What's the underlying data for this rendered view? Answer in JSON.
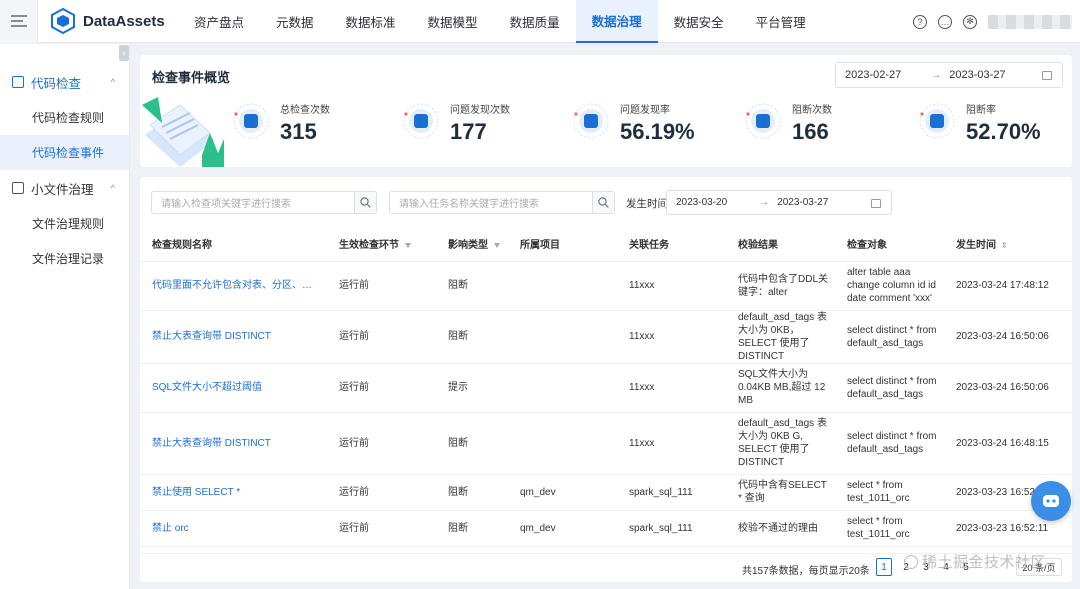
{
  "brand": {
    "name": "DataAssets"
  },
  "nav": [
    "资产盘点",
    "元数据",
    "数据标准",
    "数据模型",
    "数据质量",
    "数据治理",
    "数据安全",
    "平台管理"
  ],
  "nav_active_index": 5,
  "top_icons": [
    "help-icon",
    "message-icon",
    "settings-icon"
  ],
  "sidebar": {
    "groups": [
      {
        "label": "代码检查",
        "active": true,
        "items": [
          "代码检查规则",
          "代码检查事件"
        ]
      },
      {
        "label": "小文件治理",
        "active": false,
        "items": [
          "文件治理规则",
          "文件治理记录"
        ]
      }
    ],
    "active_item": "代码检查事件"
  },
  "overview": {
    "title": "检查事件概览",
    "range_start": "2023-02-27",
    "range_end": "2023-03-27",
    "stats": [
      {
        "label": "总检查次数",
        "value": "315"
      },
      {
        "label": "问题发现次数",
        "value": "177"
      },
      {
        "label": "问题发现率",
        "value": "56.19%"
      },
      {
        "label": "阻断次数",
        "value": "166"
      },
      {
        "label": "阻断率",
        "value": "52.70%"
      }
    ]
  },
  "filters": {
    "search1_placeholder": "请输入检查项关键字进行搜索",
    "search2_placeholder": "请输入任务名称关键字进行搜索",
    "date_label": "发生时间",
    "date_start": "2023-03-20",
    "date_end": "2023-03-27"
  },
  "table": {
    "columns": [
      "检查规则名称",
      "生效检查环节",
      "影响类型",
      "所属项目",
      "关联任务",
      "校验结果",
      "检查对象",
      "发生时间"
    ],
    "rows": [
      {
        "rule": "代码里面不允许包含对表、分区、列的D...",
        "stage": "运行前",
        "impact": "阻断",
        "project": "",
        "task": "11xxx",
        "result": "代码中包含了DDL关键字：alter",
        "object": "alter table aaa change column id id date comment 'xxx'",
        "time": "2023-03-24 17:48:12"
      },
      {
        "rule": "禁止大表查询带 DISTINCT",
        "stage": "运行前",
        "impact": "阻断",
        "project": "",
        "task": "11xxx",
        "result": "default_asd_tags 表大小为 0KB，SELECT 使用了 DISTINCT",
        "object": "select distinct * from default_asd_tags",
        "time": "2023-03-24 16:50:06"
      },
      {
        "rule": "SQL文件大小不超过阈值",
        "stage": "运行前",
        "impact": "提示",
        "project": "",
        "task": "11xxx",
        "result": "SQL文件大小为 0.04KB MB,超过 12 MB",
        "object": "select distinct * from default_asd_tags",
        "time": "2023-03-24 16:50:06"
      },
      {
        "rule": "禁止大表查询带 DISTINCT",
        "stage": "运行前",
        "impact": "阻断",
        "project": "",
        "task": "11xxx",
        "result": "default_asd_tags 表大小为 0KB G, SELECT 使用了 DISTINCT",
        "object": "select distinct * from default_asd_tags",
        "time": "2023-03-24 16:48:15"
      },
      {
        "rule": "禁止使用 SELECT *",
        "stage": "运行前",
        "impact": "阻断",
        "project": "qm_dev",
        "task": "spark_sql_111",
        "result": "代码中含有SELECT * 查询",
        "object": "select * from test_1011_orc",
        "time": "2023-03-23 16:52:11"
      },
      {
        "rule": "禁止 orc",
        "stage": "运行前",
        "impact": "阻断",
        "project": "qm_dev",
        "task": "spark_sql_111",
        "result": "校验不通过的理由",
        "object": "select * from test_1011_orc",
        "time": "2023-03-23 16:52:11"
      }
    ]
  },
  "pagination": {
    "total_text": "共157条数据，每页显示20条",
    "pages": [
      "1",
      "2",
      "3",
      "4",
      "5"
    ],
    "current": "1",
    "page_size": "20 条/页"
  },
  "watermark": "稀土掘金技术社区",
  "colors": {
    "primary": "#1a6fd6",
    "accent_green": "#2bbf8a"
  }
}
